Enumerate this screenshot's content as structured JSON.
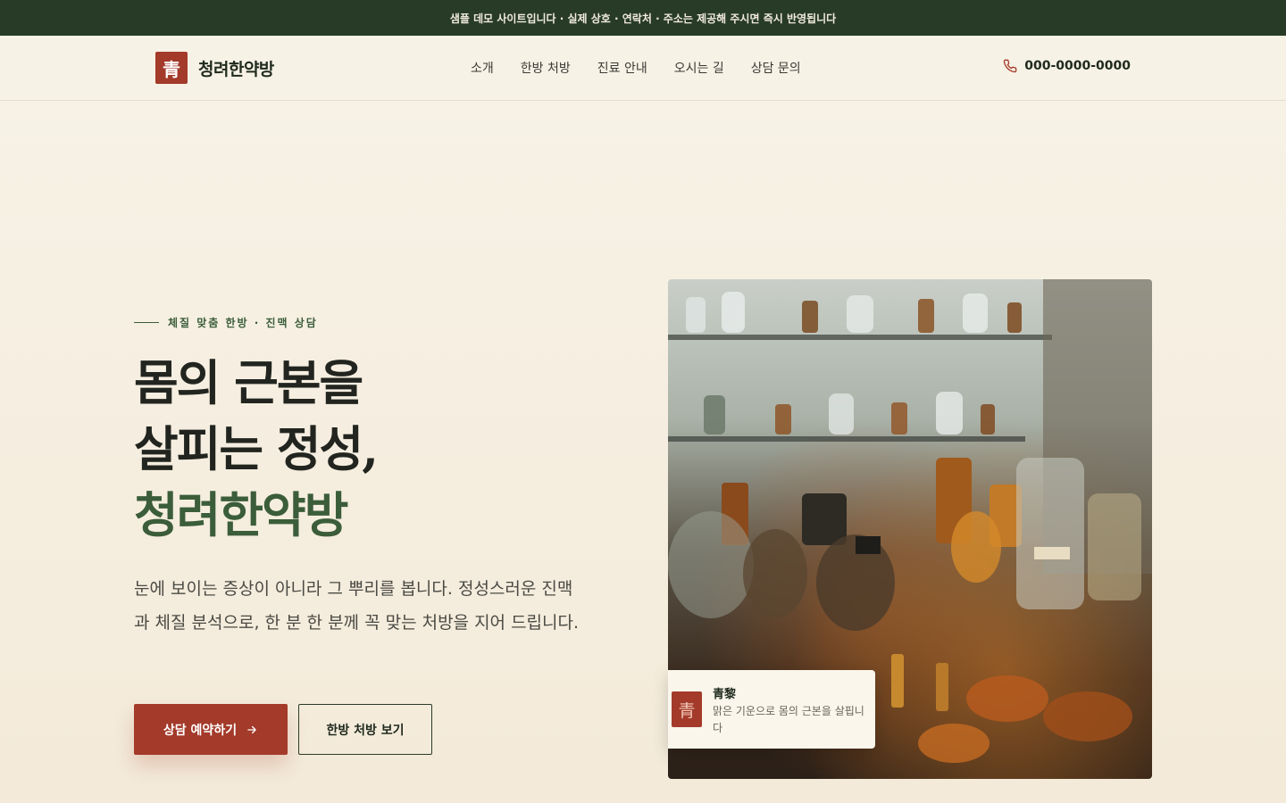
{
  "topbar": {
    "notice": "샘플 데모 사이트입니다 · 실제 상호 · 연락처 · 주소는 제공해 주시면 즉시 반영됩니다"
  },
  "header": {
    "logo_mark": "青",
    "logo_text": "청려한약방",
    "nav": [
      "소개",
      "한방 처방",
      "진료 안내",
      "오시는 길",
      "상담 문의"
    ],
    "phone": "000-0000-0000"
  },
  "hero": {
    "eyebrow": "체질 맞춤 한방 · 진맥 상담",
    "headline_line1": "몸의 근본을",
    "headline_line2": "살피는 정성,",
    "headline_accent": "청려한약방",
    "description": "눈에 보이는 증상이 아니라 그 뿌리를 봅니다. 정성스러운 진맥과 체질 분석으로, 한 분 한 분께 꼭 맞는 처방을 지어 드립니다.",
    "primary_button": "상담 예약하기",
    "secondary_button": "한방 처방 보기"
  },
  "caption": {
    "mark": "青",
    "title": "青黎",
    "text": "맑은 기운으로 몸의 근본을 살핍니다"
  },
  "colors": {
    "topbar": "#283b27",
    "brand_red": "#a33a2a",
    "brand_green": "#3b5d3a",
    "background": "#f7f2e6"
  },
  "icons": {
    "phone": "phone-icon",
    "arrow": "arrow-right-icon"
  }
}
